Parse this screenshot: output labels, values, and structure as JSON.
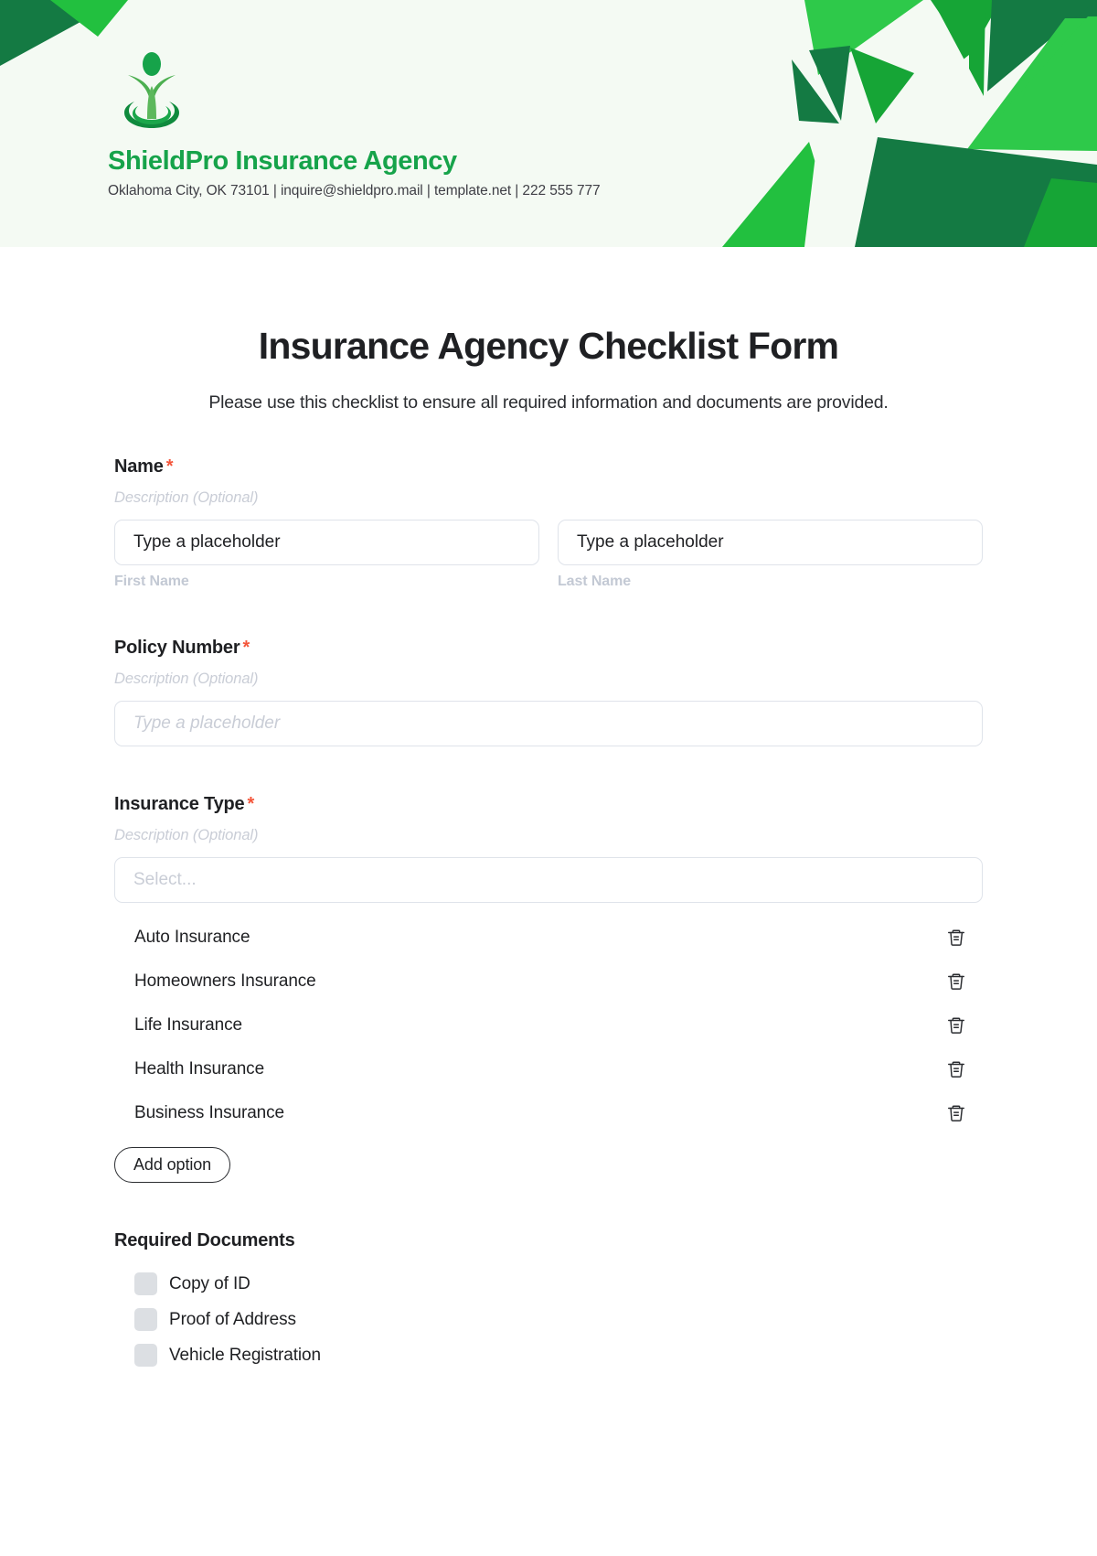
{
  "header": {
    "brand_name": "ShieldPro Insurance Agency",
    "contact_line": "Oklahoma City, OK 73101 | inquire@shieldpro.mail | template.net | 222 555 777",
    "logo_icon": "person-sprout-logo-icon",
    "colors": {
      "banner_bg": "#f4faf3",
      "green_bright": "#2ec94a",
      "green_medium": "#16a536",
      "green_dark": "#147a43",
      "brand_text": "#16a34a"
    }
  },
  "form": {
    "title": "Insurance Agency Checklist Form",
    "subtitle": "Please use this checklist to ensure all required information and documents are provided.",
    "required_marker": "*",
    "description_placeholder": "Description (Optional)",
    "fields": {
      "name": {
        "label": "Name",
        "required": true,
        "description": "Description (Optional)",
        "first": {
          "placeholder": "Type a placeholder",
          "value": "Type a placeholder",
          "sub_label": "First Name"
        },
        "last": {
          "placeholder": "Type a placeholder",
          "value": "Type a placeholder",
          "sub_label": "Last Name"
        }
      },
      "policy_number": {
        "label": "Policy Number",
        "required": true,
        "description": "Description (Optional)",
        "placeholder": "Type a placeholder",
        "value": ""
      },
      "insurance_type": {
        "label": "Insurance Type",
        "required": true,
        "description": "Description (Optional)",
        "select_placeholder": "Select...",
        "selected_value": "",
        "options": [
          "Auto Insurance",
          "Homeowners Insurance",
          "Life Insurance",
          "Health Insurance",
          "Business Insurance"
        ],
        "delete_icon": "trash-icon",
        "add_option_label": "Add option"
      },
      "required_documents": {
        "label": "Required Documents",
        "required": false,
        "items": [
          {
            "label": "Copy of ID",
            "checked": false
          },
          {
            "label": "Proof of Address",
            "checked": false
          },
          {
            "label": "Vehicle Registration",
            "checked": false
          }
        ]
      }
    }
  }
}
